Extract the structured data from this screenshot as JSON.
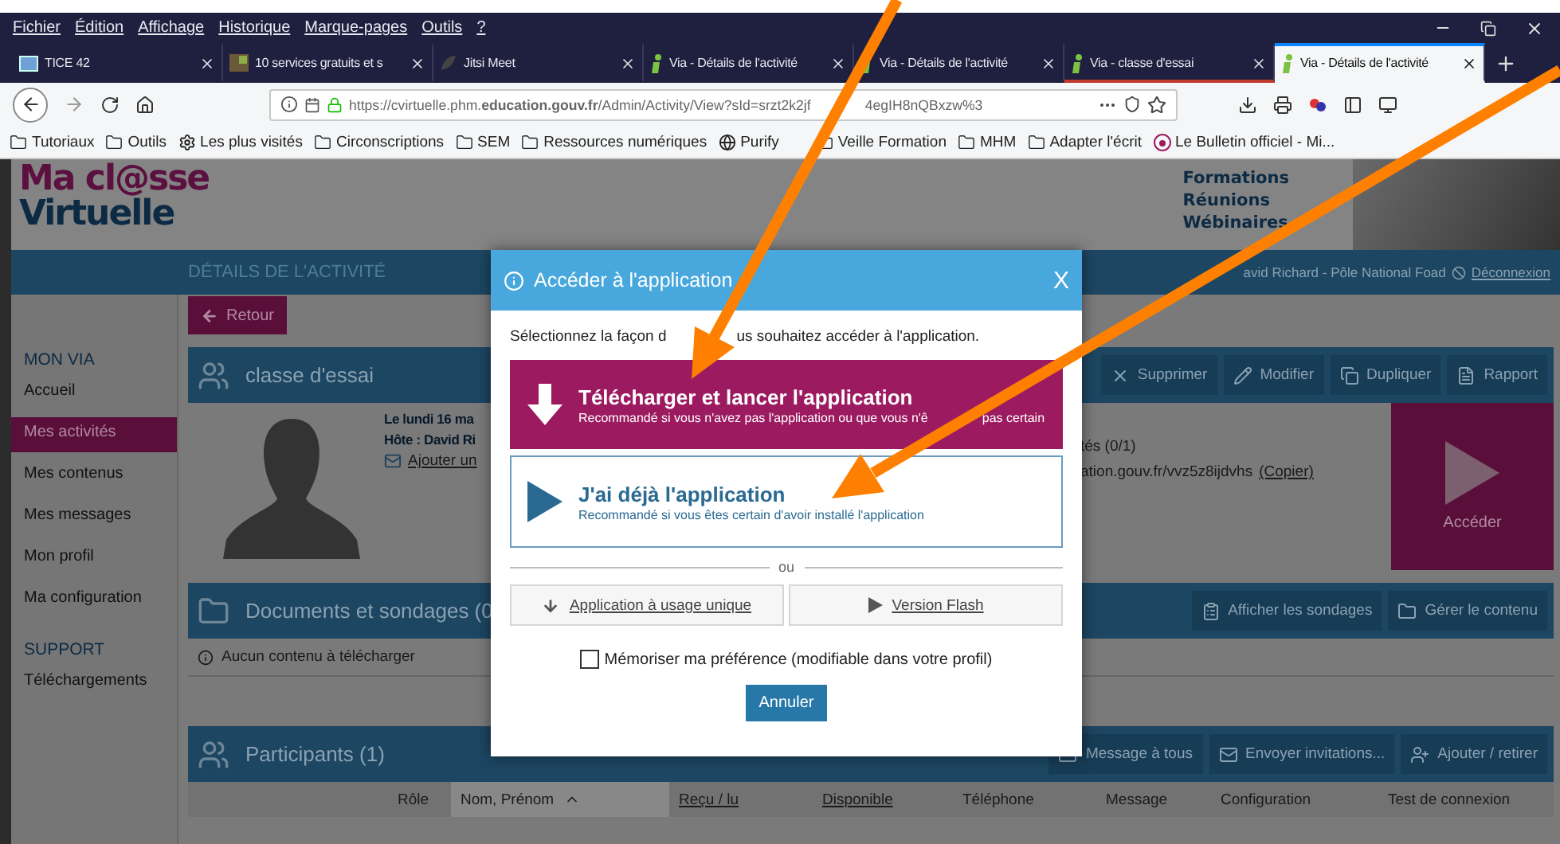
{
  "menu_bar": [
    "Fichier",
    "Édition",
    "Affichage",
    "Historique",
    "Marque-pages",
    "Outils",
    "?"
  ],
  "tabs": [
    {
      "label": "TICE 42",
      "kind": "square",
      "selected": false,
      "highlighted": false
    },
    {
      "label": "10 services gratuits et s",
      "kind": "photo",
      "selected": false,
      "highlighted": false
    },
    {
      "label": "Jitsi Meet",
      "kind": "leaf",
      "selected": false,
      "highlighted": false
    },
    {
      "label": "Via - Détails de l'activité",
      "kind": "via",
      "selected": false,
      "highlighted": false
    },
    {
      "label": "Via - Détails de l'activité",
      "kind": "via",
      "selected": false,
      "highlighted": false
    },
    {
      "label": "Via - classe d'essai",
      "kind": "via",
      "selected": false,
      "highlighted": true
    },
    {
      "label": "Via - Détails de l'activité",
      "kind": "via",
      "selected": true,
      "highlighted": false
    }
  ],
  "address_bar": {
    "url": "https://cvirtuelle.phm.**education.gouv.fr**/Admin/Activity/View?sId=srzt2k2jf",
    "url_after": "4egIH8nQBxzw%3"
  },
  "bookmarks": [
    {
      "label": "Tutoriaux",
      "kind": "folder"
    },
    {
      "label": "Outils",
      "kind": "folder"
    },
    {
      "label": "Les plus visités",
      "kind": "gear"
    },
    {
      "label": "Circonscriptions",
      "kind": "folder"
    },
    {
      "label": "SEM",
      "kind": "folder"
    },
    {
      "label": "Ressources numériques",
      "kind": "folder"
    },
    {
      "label": "Purify",
      "kind": "globe"
    },
    {
      "label": "Veille Formation",
      "kind": "folder"
    },
    {
      "label": "MHM",
      "kind": "folder"
    },
    {
      "label": "Adapter l'écrit",
      "kind": "folder"
    },
    {
      "label": "Le Bulletin officiel - Mi...",
      "kind": "site"
    }
  ],
  "site_header": {
    "logo_line1": "Ma cl@sse",
    "logo_line2": "Virtuelle",
    "taglines": [
      "Formations",
      "Réunions",
      "Wébinaires"
    ]
  },
  "top_bar": {
    "title": "DÉTAILS DE L'ACTIVITÉ",
    "user": "avid Richard - Pôle National Foad",
    "logout": "Déconnexion"
  },
  "sidebar": {
    "sections": [
      {
        "heading": "MON VIA",
        "items": [
          {
            "label": "Accueil",
            "selected": false
          },
          {
            "label": "Mes activités",
            "selected": true
          },
          {
            "label": "Mes contenus",
            "selected": false
          },
          {
            "label": "Mes messages",
            "selected": false
          },
          {
            "label": "Mon profil",
            "selected": false
          },
          {
            "label": "Ma configuration",
            "selected": false
          }
        ]
      },
      {
        "heading": "SUPPORT",
        "items": [
          {
            "label": "Téléchargements",
            "selected": false
          }
        ]
      }
    ]
  },
  "back_button": "Retour",
  "activity_panel": {
    "title": "classe d'essai",
    "actions": [
      {
        "label": "Supprimer",
        "kind": "delete"
      },
      {
        "label": "Modifier",
        "kind": "edit"
      },
      {
        "label": "Dupliquer",
        "kind": "duplicate"
      },
      {
        "label": "Rapport",
        "kind": "report"
      }
    ],
    "date": "Le lundi 16 ma",
    "host": "Hôte : David Ri",
    "add_link": "Ajouter un",
    "availability": "tés (0/1)",
    "link": "ation.gouv.fr/vvz5z8ijdvhs",
    "copy_link": "(Copier)",
    "access_button": "Accéder"
  },
  "documents_panel": {
    "title": "Documents et sondages (0",
    "actions": [
      {
        "label": "Afficher les sondages",
        "kind": "survey"
      },
      {
        "label": "Gérer le contenu",
        "kind": "folder"
      }
    ],
    "empty_message": "Aucun contenu à télécharger"
  },
  "participants_panel": {
    "title": "Participants (1)",
    "actions": [
      {
        "label": "Message à tous",
        "kind": "mail"
      },
      {
        "label": "Envoyer invitations...",
        "kind": "mail"
      },
      {
        "label": "Ajouter / retirer",
        "kind": "user"
      }
    ],
    "columns": [
      {
        "label": "Rôle",
        "kind": "plain"
      },
      {
        "label": "Nom, Prénom",
        "kind": "sorted"
      },
      {
        "label": "Reçu / lu",
        "kind": "link"
      },
      {
        "label": "Disponible",
        "kind": "link"
      },
      {
        "label": "Téléphone",
        "kind": "plain"
      },
      {
        "label": "Message",
        "kind": "plain"
      },
      {
        "label": "Configuration",
        "kind": "plain"
      },
      {
        "label": "Test de connexion",
        "kind": "plain"
      }
    ]
  },
  "dialog": {
    "title": "Accéder à l'application",
    "close": "X",
    "prompt": "Sélectionnez la façon d",
    "prompt_after": "us souhaitez accéder à l'application.",
    "options": [
      {
        "kind": "download",
        "title": "Télécharger et lancer l'application",
        "subtitle": "Recommandé si vous n'avez pas l'application ou que vous n'ê",
        "subtitle_after": "pas certain"
      },
      {
        "kind": "launch",
        "title": "J'ai déjà l'application",
        "subtitle": "Recommandé si vous êtes certain d'avoir installé l'application"
      }
    ],
    "separator": "ou",
    "alternatives": [
      {
        "kind": "download",
        "label": "Application à usage unique"
      },
      {
        "kind": "play",
        "label": "Version Flash"
      }
    ],
    "remember": {
      "label": "Mémoriser ma préférence (modifiable dans votre profil)",
      "checked": false
    },
    "cancel": "Annuler"
  }
}
